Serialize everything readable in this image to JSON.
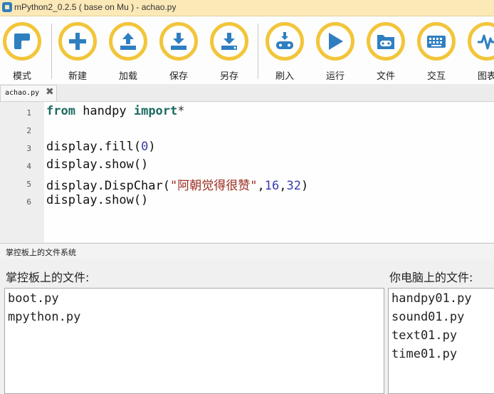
{
  "window": {
    "title": "mPython2_0.2.5 ( base on Mu ) - achao.py"
  },
  "toolbar": {
    "buttons": [
      {
        "label": "模式",
        "icon": "mode-icon"
      },
      {
        "label": "新建",
        "icon": "plus-icon"
      },
      {
        "label": "加载",
        "icon": "upload-icon"
      },
      {
        "label": "保存",
        "icon": "download-icon"
      },
      {
        "label": "另存",
        "icon": "save-as-icon"
      },
      {
        "label": "刷入",
        "icon": "flash-icon"
      },
      {
        "label": "运行",
        "icon": "play-icon"
      },
      {
        "label": "文件",
        "icon": "files-icon"
      },
      {
        "label": "交互",
        "icon": "keyboard-icon"
      },
      {
        "label": "图表",
        "icon": "chart-icon"
      }
    ]
  },
  "tab": {
    "label": "achao.py",
    "close": "✖"
  },
  "editor": {
    "lines": [
      {
        "num": "1",
        "parts": [
          {
            "t": "from",
            "c": "kw"
          },
          {
            "t": " handpy ",
            "c": ""
          },
          {
            "t": "import",
            "c": "kw"
          },
          {
            "t": "*",
            "c": "op"
          }
        ]
      },
      {
        "num": "2",
        "parts": []
      },
      {
        "num": "3",
        "parts": [
          {
            "t": "display.fill(",
            "c": ""
          },
          {
            "t": "0",
            "c": "num"
          },
          {
            "t": ")",
            "c": ""
          }
        ]
      },
      {
        "num": "4",
        "parts": [
          {
            "t": "display.show()",
            "c": ""
          }
        ]
      },
      {
        "num": "5",
        "parts": [
          {
            "t": "display.DispChar(",
            "c": ""
          },
          {
            "t": "\"阿朝觉得很赞\"",
            "c": "str"
          },
          {
            "t": ",",
            "c": ""
          },
          {
            "t": "16",
            "c": "num"
          },
          {
            "t": ",",
            "c": ""
          },
          {
            "t": "32",
            "c": "num"
          },
          {
            "t": ")",
            "c": ""
          }
        ]
      },
      {
        "num": "6",
        "parts": [
          {
            "t": "display.show()",
            "c": ""
          }
        ]
      }
    ]
  },
  "files_panel": {
    "header": "掌控板上的文件系统",
    "device_title": "掌控板上的文件:",
    "device_files": [
      "boot.py",
      "mpython.py"
    ],
    "computer_title": "你电脑上的文件:",
    "computer_files": [
      "handpy01.py",
      "sound01.py",
      "text01.py",
      "time01.py"
    ]
  },
  "colors": {
    "accent_ring": "#f2c53a",
    "icon_blue": "#2f7fc0",
    "titlebar": "#fce9b8"
  }
}
